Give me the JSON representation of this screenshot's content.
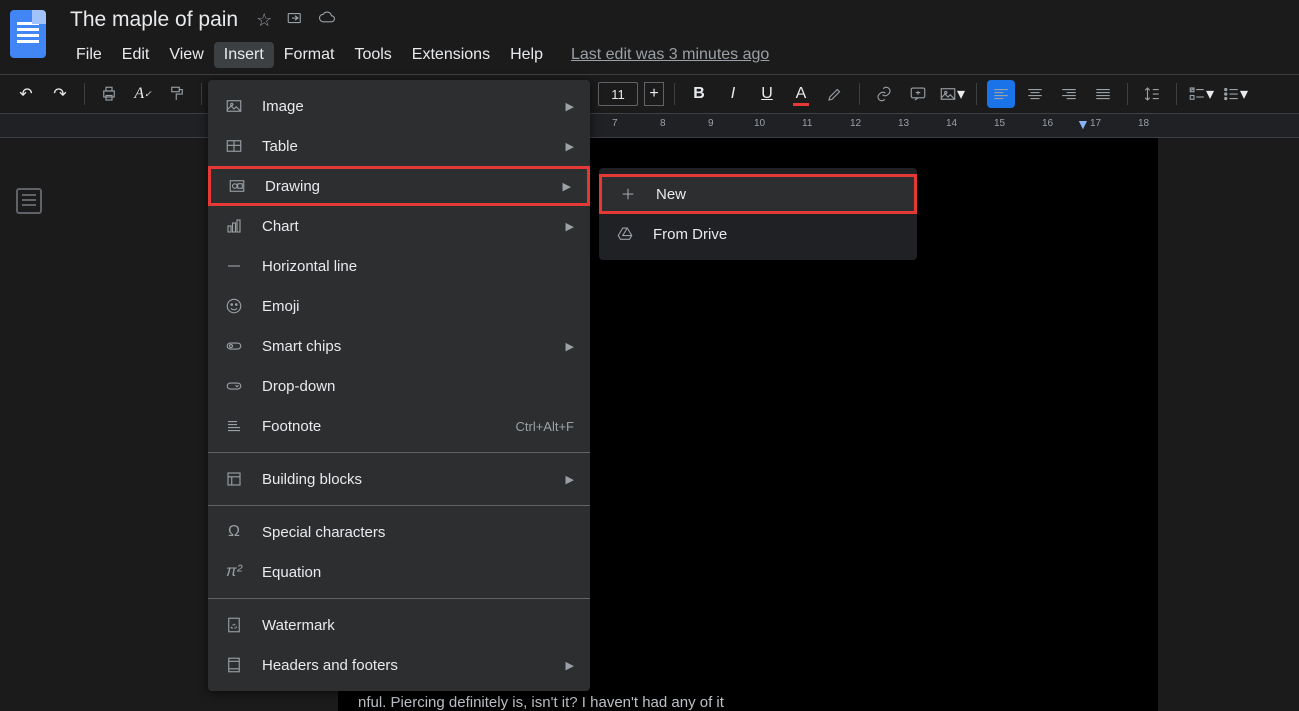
{
  "header": {
    "title": "The maple of pain",
    "menus": [
      "File",
      "Edit",
      "View",
      "Insert",
      "Format",
      "Tools",
      "Extensions",
      "Help"
    ],
    "last_edit": "Last edit was 3 minutes ago"
  },
  "toolbar": {
    "font_size": "11"
  },
  "insert_menu": {
    "image": "Image",
    "table": "Table",
    "drawing": "Drawing",
    "chart": "Chart",
    "hline": "Horizontal line",
    "emoji": "Emoji",
    "smart_chips": "Smart chips",
    "dropdown": "Drop-down",
    "footnote": "Footnote",
    "footnote_sc": "Ctrl+Alt+F",
    "building_blocks": "Building blocks",
    "special_chars": "Special characters",
    "equation": "Equation",
    "watermark": "Watermark",
    "headers_footers": "Headers and footers"
  },
  "drawing_submenu": {
    "new": "New",
    "from_drive": "From Drive"
  },
  "ruler": {
    "numbers": [
      "7",
      "8",
      "9",
      "10",
      "11",
      "12",
      "13",
      "14",
      "15",
      "16",
      "17",
      "18"
    ]
  },
  "document_text": "nful. Piercing definitely is, isn't it? I haven't had any of it"
}
